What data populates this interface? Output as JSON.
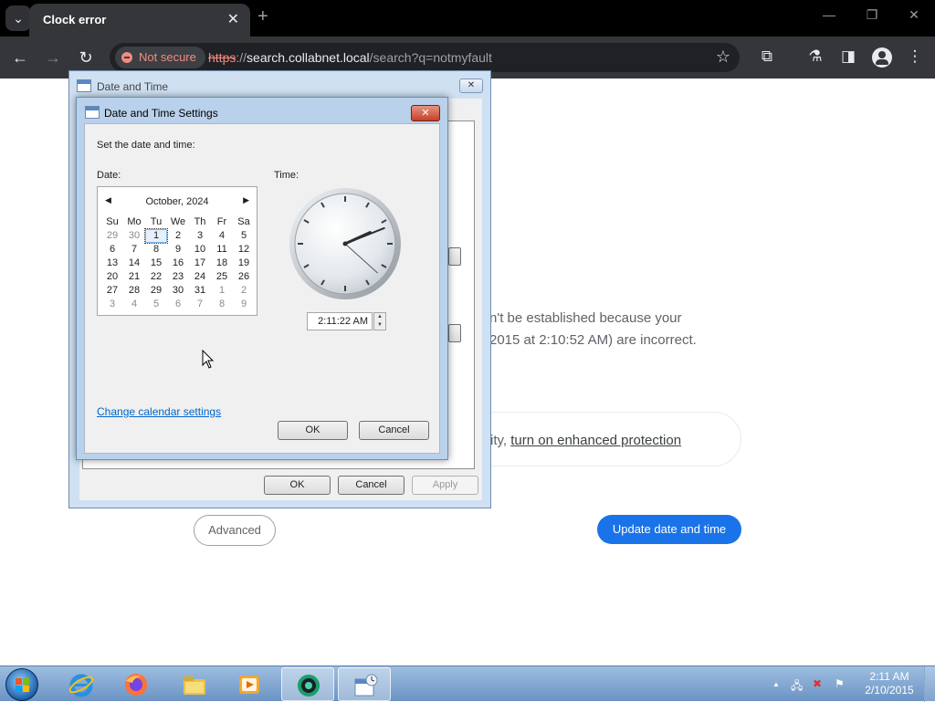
{
  "browser": {
    "tab_title": "Clock error",
    "tab_close": "✕",
    "new_tab": "+",
    "security_chip": "Not secure",
    "url_scheme": "https",
    "url_sep": "://",
    "url_host": "search.collabnet.local",
    "url_path": "/search?q=notmyfault",
    "icons": [
      "tab-search-icon",
      "back-icon",
      "forward-icon",
      "reload-icon",
      "not-secure-icon",
      "bookmark-star-icon",
      "extensions-icon",
      "labs-icon",
      "side-panel-icon",
      "profile-icon",
      "menu-icon",
      "minimize-icon",
      "restore-icon",
      "close-icon"
    ]
  },
  "page": {
    "line1": "n't be established because your",
    "line2": "2015 at 2:10:52 AM) are incorrect.",
    "card_prefix": "ity, ",
    "card_link": "turn on enhanced protection",
    "advanced_label": "Advanced",
    "update_label": "Update date and time",
    "accent": "#1a73e8"
  },
  "outer_dialog": {
    "title": "Date and Time",
    "close": "✕",
    "ok": "OK",
    "cancel": "Cancel",
    "apply": "Apply"
  },
  "settings_dialog": {
    "title": "Date and Time Settings",
    "close": "✕",
    "instruction": "Set the date and time:",
    "date_label": "Date:",
    "time_label": "Time:",
    "month_year": "October, 2024",
    "weekdays": [
      "Su",
      "Mo",
      "Tu",
      "We",
      "Th",
      "Fr",
      "Sa"
    ],
    "weeks": [
      [
        "29",
        "30",
        "1",
        "2",
        "3",
        "4",
        "5"
      ],
      [
        "6",
        "7",
        "8",
        "9",
        "10",
        "11",
        "12"
      ],
      [
        "13",
        "14",
        "15",
        "16",
        "17",
        "18",
        "19"
      ],
      [
        "20",
        "21",
        "22",
        "23",
        "24",
        "25",
        "26"
      ],
      [
        "27",
        "28",
        "29",
        "30",
        "31",
        "1",
        "2"
      ],
      [
        "3",
        "4",
        "5",
        "6",
        "7",
        "8",
        "9"
      ]
    ],
    "selected_day": "1",
    "time_value": "2:11:22 AM",
    "change_calendar_link": "Change calendar settings",
    "ok": "OK",
    "cancel": "Cancel"
  },
  "taskbar": {
    "apps": [
      "internet-explorer-icon",
      "firefox-icon",
      "file-explorer-icon",
      "media-player-icon",
      "app-icon",
      "date-time-icon"
    ],
    "active_apps": [
      "app-icon",
      "date-time-icon"
    ],
    "tray_up": "▲",
    "clock_time": "2:11 AM",
    "clock_date": "2/10/2015"
  }
}
